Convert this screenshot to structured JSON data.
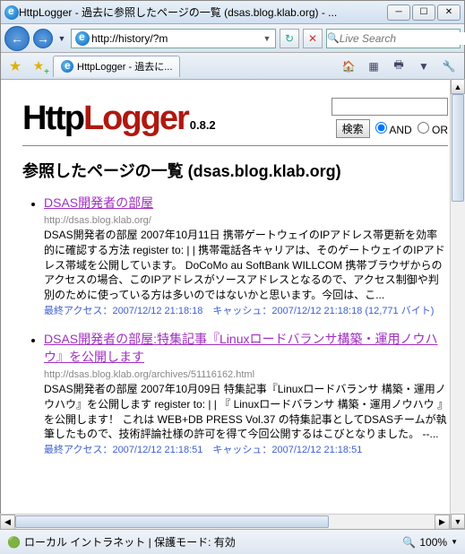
{
  "window": {
    "title": "HttpLogger - 過去に参照したページの一覧 (dsas.blog.klab.org) - ..."
  },
  "nav": {
    "address": "http://history/?m",
    "search_placeholder": "Live Search"
  },
  "tab": {
    "label": "HttpLogger - 過去に..."
  },
  "page": {
    "logo_http": "Http",
    "logo_logger": "Logger",
    "version": "0.8.2",
    "search_button": "検索",
    "opt_and": "AND",
    "opt_or": "OR",
    "heading": "参照したページの一覧 (dsas.blog.klab.org)",
    "results": [
      {
        "title": "DSAS開発者の部屋",
        "url": "http://dsas.blog.klab.org/",
        "desc": "DSAS開発者の部屋 2007年10月11日 携帯ゲートウェイのIPアドレス帯更新を効率的に確認する方法 register to: | | 携帯電話各キャリアは、そのゲートウェイのIPアドレス帯域を公開しています。 DoCoMo au SoftBank WILLCOM 携帯ブラウザからのアクセスの場合、このIPアドレスがソースアドレスとなるので、アクセス制御や判別のために使っている方は多いのではないかと思います。今回は、こ...",
        "meta": "最終アクセス：2007/12/12 21:18:18　キャッシュ：2007/12/12 21:18:18 (12,771 バイト)"
      },
      {
        "title": "DSAS開発者の部屋:特集記事『Linuxロードバランサ構築・運用ノウハウ』を公開します",
        "url": "http://dsas.blog.klab.org/archives/51116162.html",
        "desc": "DSAS開発者の部屋 2007年10月09日 特集記事『Linuxロードバランサ 構築・運用ノウハウ』を公開します register to: | | 『 Linuxロードバランサ 構築・運用ノウハウ 』を公開します！ これは WEB+DB PRESS Vol.37 の特集記事としてDSASチームが執筆したもので、技術評論社様の許可を得て今回公開するはこびとなりました。 --...",
        "meta": "最終アクセス：2007/12/12 21:18:51　キャッシュ：2007/12/12 21:18:51"
      }
    ]
  },
  "status": {
    "zone": "ローカル イントラネット | 保護モード: 有効",
    "zoom": "100%"
  }
}
